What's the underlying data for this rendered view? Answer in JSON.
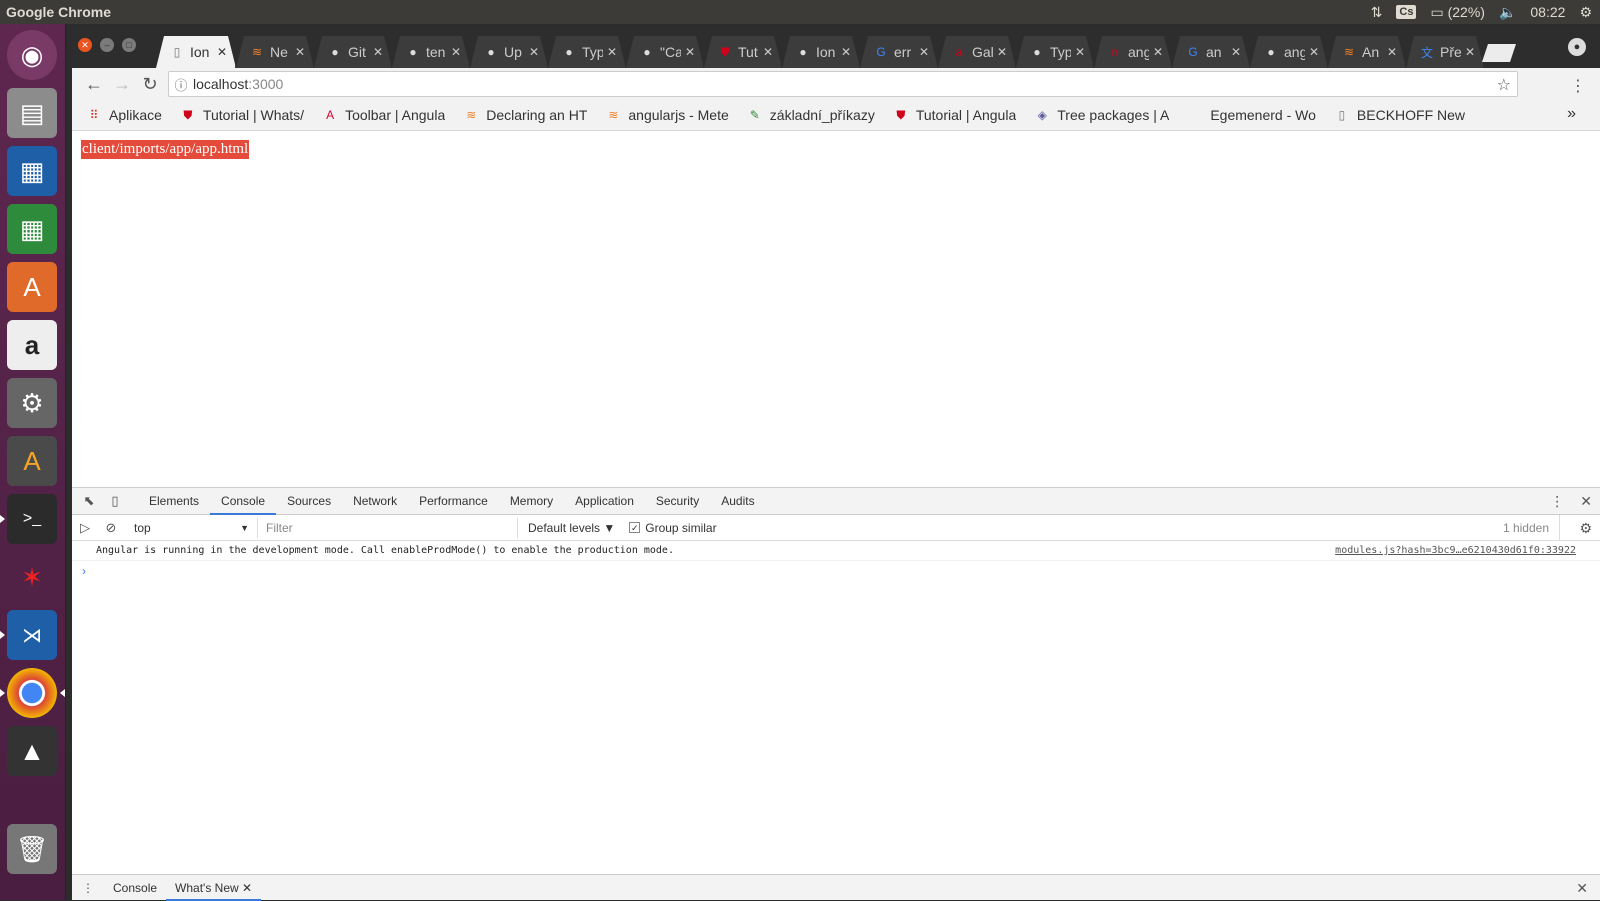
{
  "os": {
    "app_title": "Google Chrome",
    "tray": {
      "keyboard": "Cs",
      "battery": "(22%)",
      "clock": "08:22"
    }
  },
  "launcher": {
    "items": [
      "ubuntu-dash",
      "files",
      "libreoffice-writer",
      "libreoffice-calc",
      "software-center",
      "amazon",
      "system-settings",
      "inkscape-a",
      "terminal",
      "game",
      "vscode",
      "chrome",
      "inkscape",
      "trash"
    ]
  },
  "browser": {
    "tabs": [
      {
        "title": "Ion",
        "icon": "doc",
        "active": true
      },
      {
        "title": "Ne",
        "icon": "so"
      },
      {
        "title": "Git",
        "icon": "gh"
      },
      {
        "title": "ten",
        "icon": "gh"
      },
      {
        "title": "Up",
        "icon": "gh"
      },
      {
        "title": "Typ",
        "icon": "gh"
      },
      {
        "title": "\"Ca",
        "icon": "gh"
      },
      {
        "title": "Tut",
        "icon": "shield"
      },
      {
        "title": "Ion",
        "icon": "gh"
      },
      {
        "title": "err",
        "icon": "g"
      },
      {
        "title": "Gal",
        "icon": "a"
      },
      {
        "title": "Typ",
        "icon": "gh"
      },
      {
        "title": "ang",
        "icon": "n"
      },
      {
        "title": "an",
        "icon": "g"
      },
      {
        "title": "ang",
        "icon": "gh"
      },
      {
        "title": "An",
        "icon": "so"
      },
      {
        "title": "Pře",
        "icon": "translate"
      }
    ],
    "address": {
      "host": "localhost",
      "port": ":3000"
    },
    "bookmarks": [
      {
        "label": "Aplikace",
        "icon": "apps"
      },
      {
        "label": "Tutorial | Whats/",
        "icon": "shield"
      },
      {
        "label": "Toolbar | Angula",
        "icon": "angular"
      },
      {
        "label": "Declaring an HT",
        "icon": "so"
      },
      {
        "label": "angularjs - Mete",
        "icon": "so"
      },
      {
        "label": "základní_příkazy",
        "icon": "edit"
      },
      {
        "label": "Tutorial | Angula",
        "icon": "shield"
      },
      {
        "label": "Tree packages | A",
        "icon": "tree"
      },
      {
        "label": "Egemenerd - Wo",
        "icon": "none"
      },
      {
        "label": "BECKHOFF New",
        "icon": "doc"
      }
    ],
    "more_label": "»"
  },
  "page": {
    "label": "client/imports/app/app.html"
  },
  "devtools": {
    "tabs": [
      "Elements",
      "Console",
      "Sources",
      "Network",
      "Performance",
      "Memory",
      "Application",
      "Security",
      "Audits"
    ],
    "active_tab": "Console",
    "context": "top",
    "filter_placeholder": "Filter",
    "levels": "Default levels ▼",
    "group_similar": "Group similar",
    "hidden_count": "1 hidden",
    "messages": [
      {
        "text": "Angular is running in the development mode. Call enableProdMode() to enable the production mode.",
        "source": "modules.js?hash=3bc9…e6210430d61f0:33922"
      }
    ],
    "prompt": "›",
    "drawer_tabs": [
      "Console",
      "What's New"
    ],
    "drawer_active": "What's New"
  }
}
